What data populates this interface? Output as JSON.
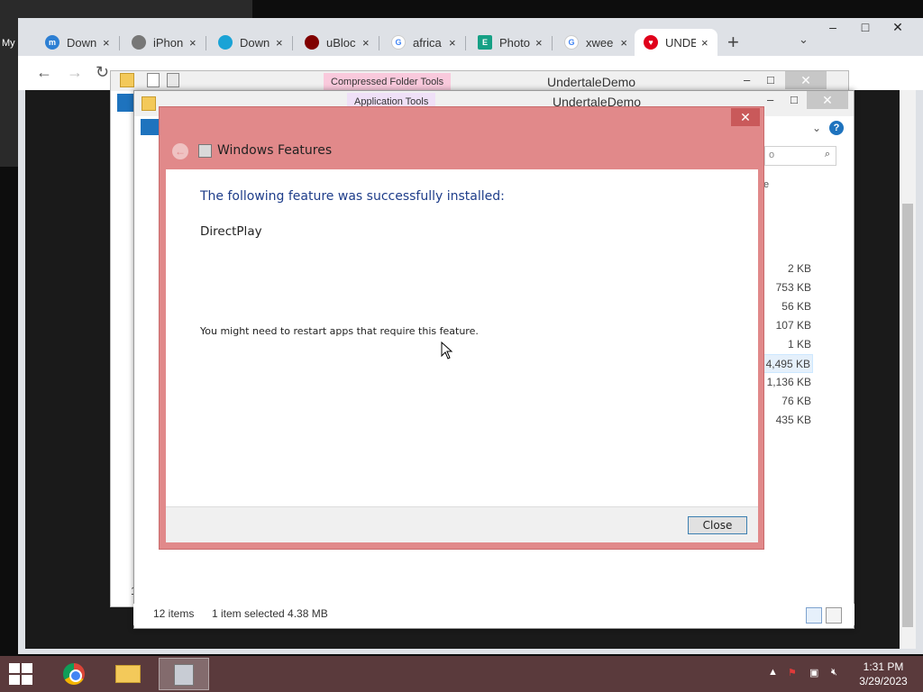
{
  "desktop": {
    "label": "My"
  },
  "browser": {
    "tabs": [
      {
        "label": "Down",
        "icon": "mu-icon",
        "color": "#2d7fd3"
      },
      {
        "label": "iPhon",
        "icon": "apple-icon",
        "color": "#555555"
      },
      {
        "label": "Down",
        "icon": "diamond-icon",
        "color": "#1aa3d6"
      },
      {
        "label": "uBloc",
        "icon": "ublock-icon",
        "color": "#800000"
      },
      {
        "label": "africa",
        "icon": "google-icon",
        "color": "#4285f4"
      },
      {
        "label": "Photo",
        "icon": "photo-icon",
        "color": "#16a085"
      },
      {
        "label": "xwee",
        "icon": "google-icon",
        "color": "#4285f4"
      },
      {
        "label": "UNDE",
        "icon": "heart-icon",
        "color": "#e0001b"
      }
    ],
    "new_tab": "+",
    "close_glyph": "×"
  },
  "explorer_back": {
    "context_tab": "Compressed Folder Tools",
    "title": "UndertaleDemo"
  },
  "explorer_front": {
    "context_tab": "Application Tools",
    "title": "UndertaleDemo",
    "search_placeholder": "o",
    "column_fragment": "e",
    "sizes": [
      "2 KB",
      "753 KB",
      "56 KB",
      "107 KB",
      "1 KB",
      "4,495 KB",
      "1,136 KB",
      "76 KB",
      "435 KB"
    ],
    "status_items": "12 items",
    "status_selected": "1 item selected  4.38 MB",
    "back_status_fragment": "1"
  },
  "dialog": {
    "title": "Windows Features",
    "heading": "The following feature was successfully installed:",
    "feature": "DirectPlay",
    "note": "You might need to restart apps that require this feature.",
    "close_button": "Close",
    "accent": "#e1898a"
  },
  "taskbar": {
    "time": "1:31 PM",
    "date": "3/29/2023",
    "color": "#5a3a3c"
  }
}
